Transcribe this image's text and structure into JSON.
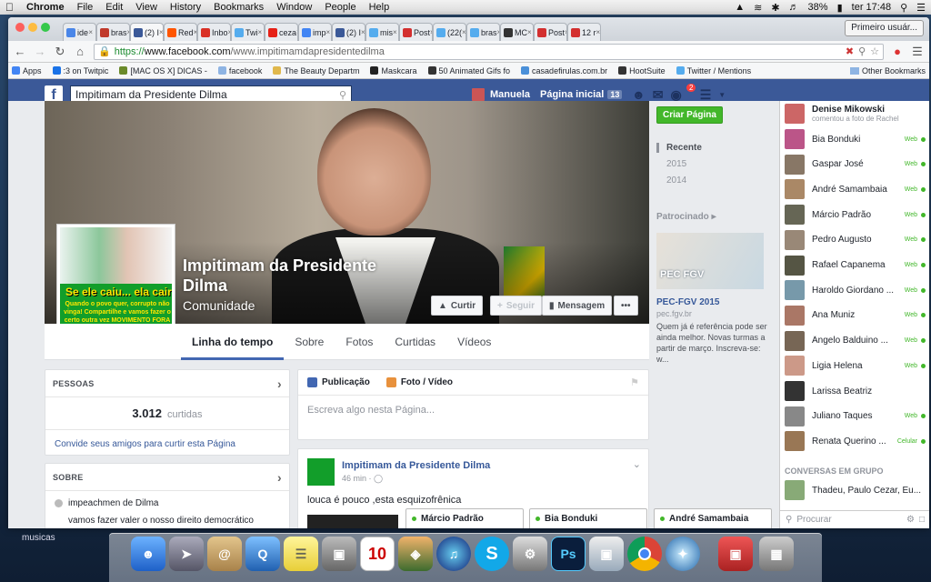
{
  "menubar": {
    "apple_icon": "apple-logo",
    "app_name": "Chrome",
    "menus": [
      "File",
      "Edit",
      "View",
      "History",
      "Bookmarks",
      "Window",
      "People",
      "Help"
    ],
    "battery": "38%",
    "clock": "ter 17:48"
  },
  "browser": {
    "tabs": [
      {
        "label": "ide",
        "color": "#4a86e8"
      },
      {
        "label": "bras",
        "color": "#c0392b"
      },
      {
        "label": "(2) I",
        "color": "#3b5998",
        "active": true
      },
      {
        "label": "Red",
        "color": "#ff5500"
      },
      {
        "label": "Inbo",
        "color": "#d93025"
      },
      {
        "label": "Twi",
        "color": "#55acee"
      },
      {
        "label": "ceza",
        "color": "#e62117"
      },
      {
        "label": "imp",
        "color": "#4285f4"
      },
      {
        "label": "(2) I",
        "color": "#3b5998"
      },
      {
        "label": "mis",
        "color": "#55acee"
      },
      {
        "label": "Post",
        "color": "#d32f2f"
      },
      {
        "label": "(22(",
        "color": "#55acee"
      },
      {
        "label": "bras",
        "color": "#55acee"
      },
      {
        "label": "MC",
        "color": "#333333"
      },
      {
        "label": "Post",
        "color": "#d32f2f"
      },
      {
        "label": "12 r",
        "color": "#d32f2f"
      }
    ],
    "profile_button": "Primeiro usuár...",
    "url_scheme": "https://",
    "url_host": "www.facebook.com",
    "url_path": "/www.impitimamdapresidentedilma",
    "bookmarks": [
      {
        "label": "Apps",
        "color": "#4285f4"
      },
      {
        "label": ":3 on Twitpic",
        "color": "#1a73e8"
      },
      {
        "label": "[MAC OS X] DICAS -",
        "color": "#6a8a2a"
      },
      {
        "label": "facebook",
        "color": "#8eb4e3"
      },
      {
        "label": "The Beauty Departm",
        "color": "#e0b84c"
      },
      {
        "label": "Maskcara",
        "color": "#222222"
      },
      {
        "label": "50 Animated Gifs fo",
        "color": "#333333"
      },
      {
        "label": "casadefirulas.com.br",
        "color": "#4a90d9"
      },
      {
        "label": "HootSuite",
        "color": "#333333"
      },
      {
        "label": "Twitter / Mentions",
        "color": "#55acee"
      }
    ],
    "other_bookmarks": "Other Bookmarks"
  },
  "fb": {
    "logo": "f",
    "search_value": "Impitimam da Presidente  Dilma",
    "user_name": "Manuela",
    "home_label": "Página inicial",
    "home_count": "13",
    "notif_count": "2",
    "page": {
      "title": "Impitimam da Presidente Dilma",
      "category": "Comunidade",
      "profile_text_main": "Se ele caiu... ela cairá!",
      "profile_text_sub": "Quando o povo quer, corrupto não vinga! Compartilhe e vamos fazer o certo outra vez MOVIMENTO FORA DILMA!",
      "buttons": {
        "like": "Curtir",
        "follow": "Seguir",
        "message": "Mensagem",
        "more": "•••"
      },
      "tabs": [
        "Linha do tempo",
        "Sobre",
        "Fotos",
        "Curtidas",
        "Vídeos"
      ]
    },
    "people": {
      "header": "PESSOAS",
      "count": "3.012",
      "count_label": "curtidas",
      "invite": "Convide seus amigos para curtir esta Página"
    },
    "about": {
      "header": "SOBRE",
      "line1": "impeachmen de Dilma",
      "line2": "vamos fazer valer o nosso direito democrático"
    },
    "composer": {
      "tab_post": "Publicação",
      "tab_photo": "Foto / Vídeo",
      "placeholder": "Escreva algo nesta Página..."
    },
    "post": {
      "author": "Impitimam da Presidente Dilma",
      "time": "46 min ·",
      "text": "louca é pouco ,esta esquizofrênica"
    },
    "chat_tabs": [
      "Márcio Padrão",
      "Bia Bonduki",
      "André Samambaia"
    ],
    "sidebar": {
      "create_page": "Criar Página",
      "years": [
        "Recente",
        "2015",
        "2014"
      ],
      "sponsored": "Patrocinado",
      "ad_title": "PEC-FGV 2015",
      "ad_domain": "pec.fgv.br",
      "ad_text": "Quem já é referência pode ser ainda melhor. Novas turmas a partir de março. Inscreva-se: w...",
      "ad_image_text": "PEC FGV"
    },
    "chat": {
      "top_name": "Denise Mikowski",
      "top_sub": "comentou a foto de Rachel",
      "contacts": [
        {
          "name": "Bia Bonduki",
          "status": "Web"
        },
        {
          "name": "Gaspar José",
          "status": "Web"
        },
        {
          "name": "André Samambaia",
          "status": "Web"
        },
        {
          "name": "Márcio Padrão",
          "status": "Web"
        },
        {
          "name": "Pedro Augusto",
          "status": "Web"
        },
        {
          "name": "Rafael Capanema",
          "status": "Web"
        },
        {
          "name": "Haroldo Giordano ...",
          "status": "Web"
        },
        {
          "name": "Ana Muniz",
          "status": "Web"
        },
        {
          "name": "Ângelo Balduino ...",
          "status": "Web"
        },
        {
          "name": "Ligia Helena",
          "status": "Web"
        },
        {
          "name": "Larissa Beatriz",
          "status": ""
        },
        {
          "name": "Juliano Taques",
          "status": "Web"
        },
        {
          "name": "Renata Querino ...",
          "status": "Celular"
        }
      ],
      "groups_header": "CONVERSAS EM GRUPO",
      "group": "Thadeu, Paulo Cezar, Eu...",
      "search_placeholder": "Procurar"
    }
  },
  "desktop": {
    "label": "musicas",
    "calendar_day": "10"
  }
}
